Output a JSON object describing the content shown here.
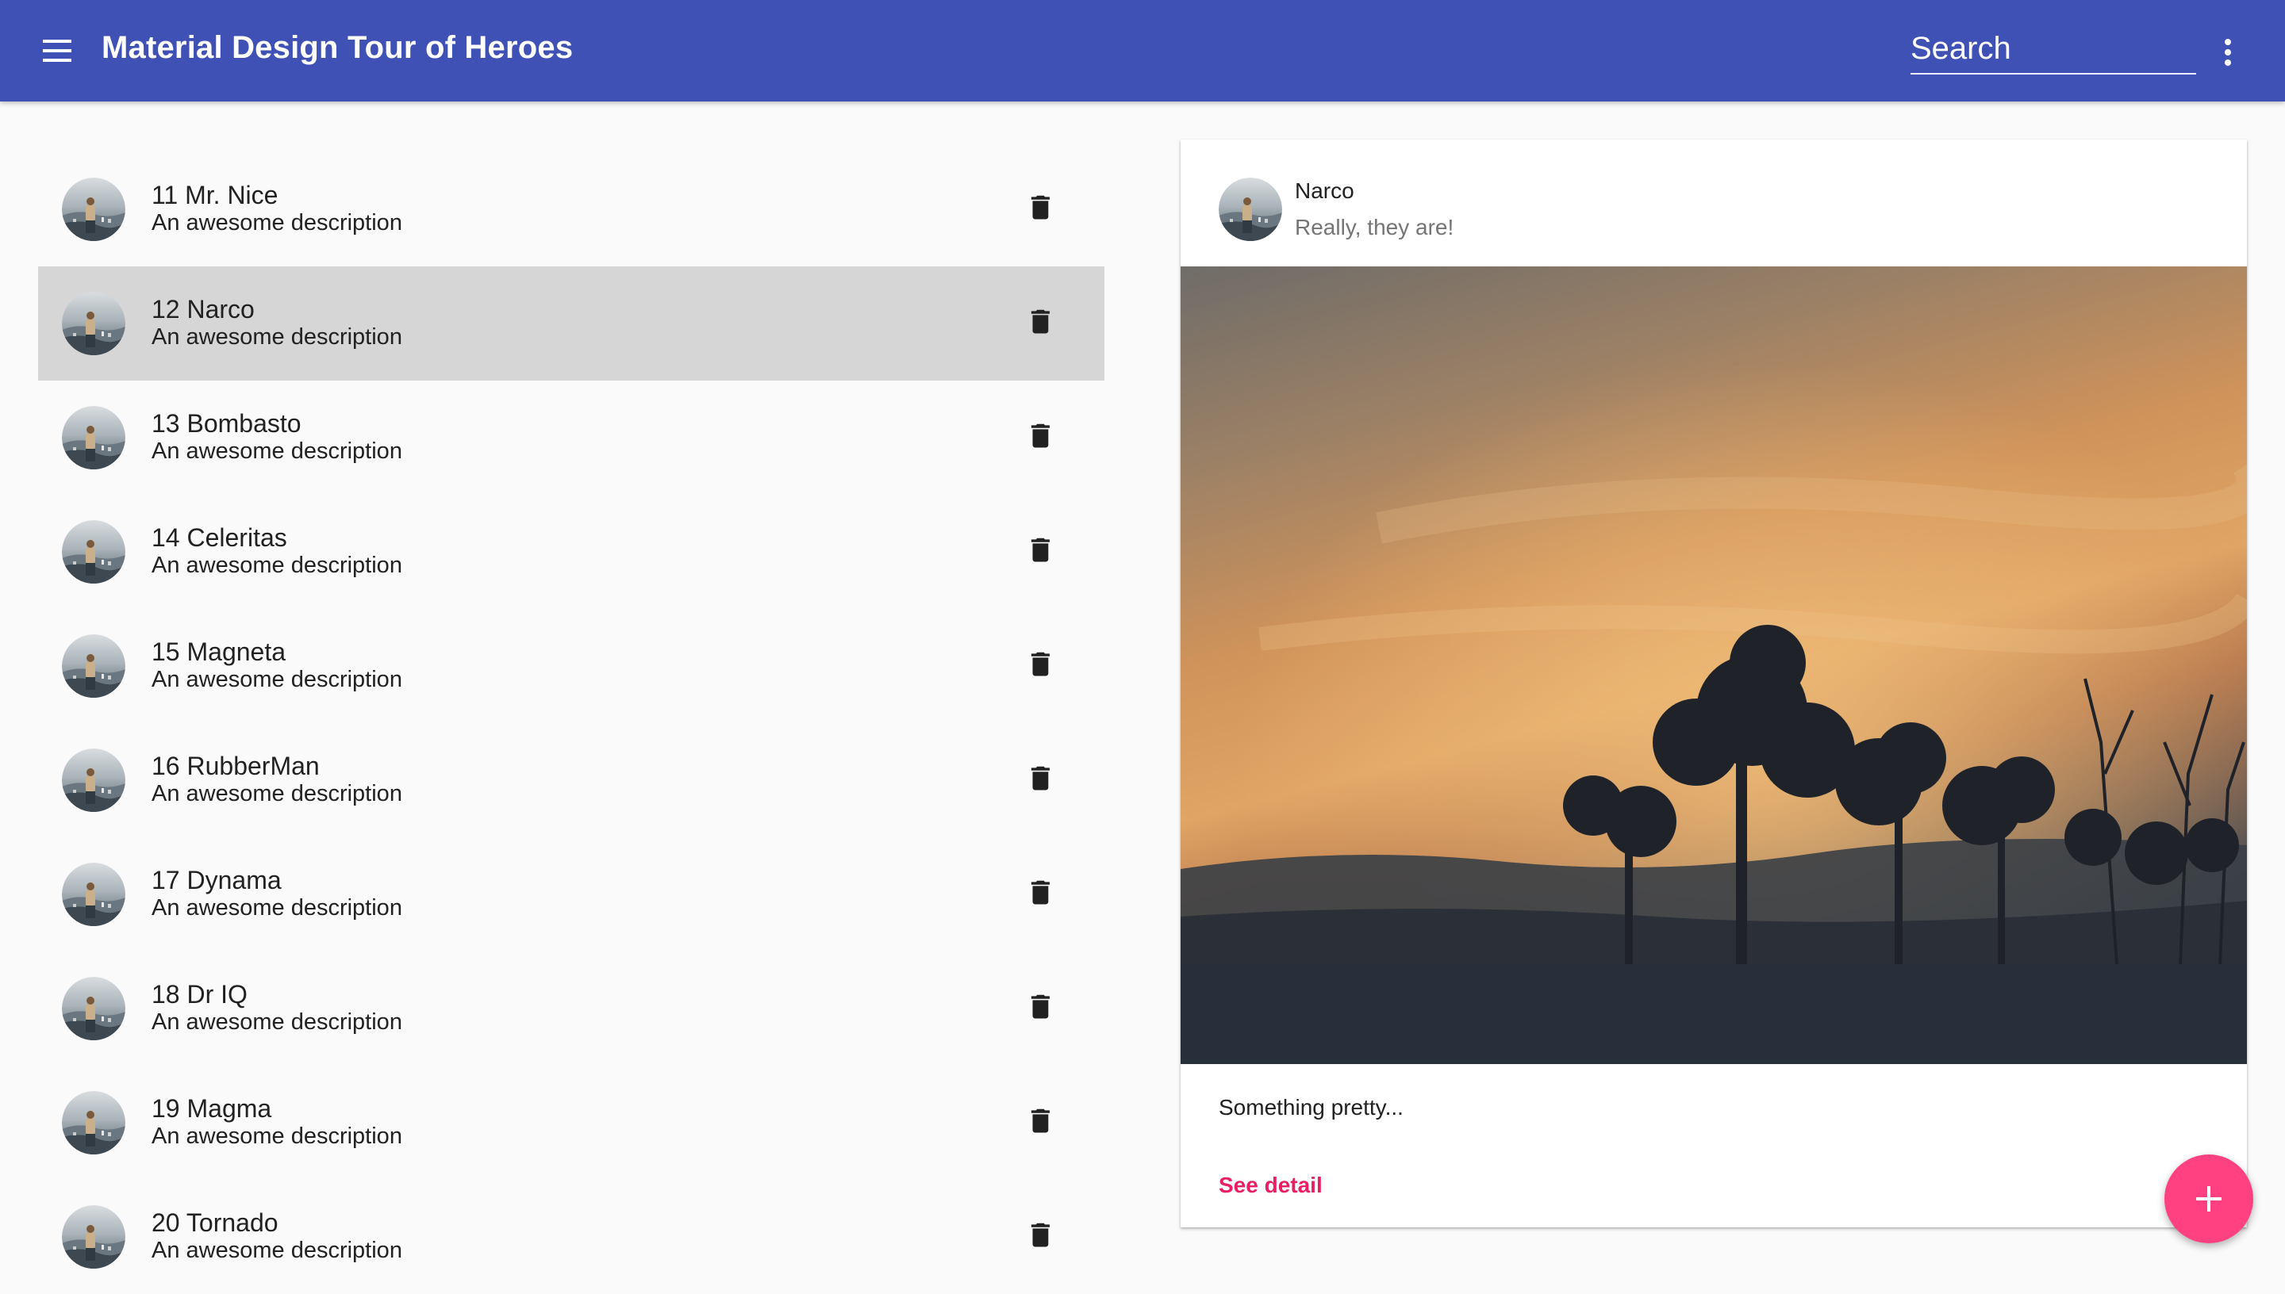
{
  "toolbar": {
    "title": "Material Design Tour of Heroes",
    "search_placeholder": "Search",
    "menu_icon": "menu-icon",
    "more_icon": "more-vert-icon",
    "color": "#3f51b5"
  },
  "heroes": [
    {
      "id": "11",
      "name": "11 Mr. Nice",
      "description": "An awesome description",
      "selected": false
    },
    {
      "id": "12",
      "name": "12 Narco",
      "description": "An awesome description",
      "selected": true
    },
    {
      "id": "13",
      "name": "13 Bombasto",
      "description": "An awesome description",
      "selected": false
    },
    {
      "id": "14",
      "name": "14 Celeritas",
      "description": "An awesome description",
      "selected": false
    },
    {
      "id": "15",
      "name": "15 Magneta",
      "description": "An awesome description",
      "selected": false
    },
    {
      "id": "16",
      "name": "16 RubberMan",
      "description": "An awesome description",
      "selected": false
    },
    {
      "id": "17",
      "name": "17 Dynama",
      "description": "An awesome description",
      "selected": false
    },
    {
      "id": "18",
      "name": "18 Dr IQ",
      "description": "An awesome description",
      "selected": false
    },
    {
      "id": "19",
      "name": "19 Magma",
      "description": "An awesome description",
      "selected": false
    },
    {
      "id": "20",
      "name": "20 Tornado",
      "description": "An awesome description",
      "selected": false
    }
  ],
  "list_icons": {
    "avatar": "avatar-photo",
    "delete": "delete-icon"
  },
  "detail_card": {
    "title": "Narco",
    "subtitle": "Really, they are!",
    "content": "Something pretty...",
    "action_label": "See detail",
    "image": "sunset-trees-photo",
    "action_color": "#e91e63"
  },
  "fab": {
    "icon": "add-icon",
    "color": "#ff4081"
  }
}
